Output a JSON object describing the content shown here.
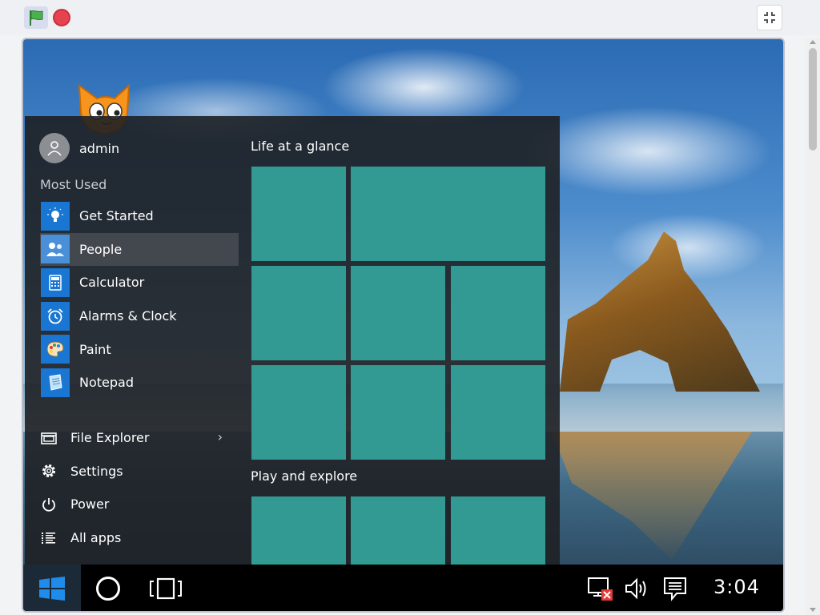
{
  "player": {
    "green_flag_icon": "green-flag-icon",
    "stop_icon": "stop-sign-icon",
    "fullscreen_icon": "exit-fullscreen-icon"
  },
  "start_menu": {
    "user": {
      "name": "admin",
      "icon": "user-avatar-icon"
    },
    "most_used_heading": "Most Used",
    "apps": [
      {
        "label": "Get Started",
        "icon": "lightbulb-icon",
        "active": false
      },
      {
        "label": "People",
        "icon": "people-icon",
        "active": true
      },
      {
        "label": "Calculator",
        "icon": "calculator-icon",
        "active": false
      },
      {
        "label": "Alarms & Clock",
        "icon": "alarm-clock-icon",
        "active": false
      },
      {
        "label": "Paint",
        "icon": "paint-palette-icon",
        "active": false
      },
      {
        "label": "Notepad",
        "icon": "notepad-icon",
        "active": false
      }
    ],
    "system": [
      {
        "label": "File Explorer",
        "icon": "file-explorer-icon",
        "chevron": "›"
      },
      {
        "label": "Settings",
        "icon": "gear-icon"
      },
      {
        "label": "Power",
        "icon": "power-icon"
      },
      {
        "label": "All apps",
        "icon": "list-icon"
      }
    ],
    "groups": [
      {
        "title": "Life at a glance"
      },
      {
        "title": "Play and explore"
      }
    ],
    "tile_color": "#339a93"
  },
  "taskbar": {
    "start_icon": "windows-logo-icon",
    "search_icon": "cortana-circle-icon",
    "task_view_icon": "task-view-icon",
    "network_icon": "network-disconnected-icon",
    "volume_icon": "speaker-icon",
    "notifications_icon": "action-center-icon",
    "clock": "3:04"
  },
  "colors": {
    "accent": "#1976d2",
    "tile": "#339a93",
    "menu_bg": "#1e2024",
    "taskbar_bg": "#000000"
  }
}
